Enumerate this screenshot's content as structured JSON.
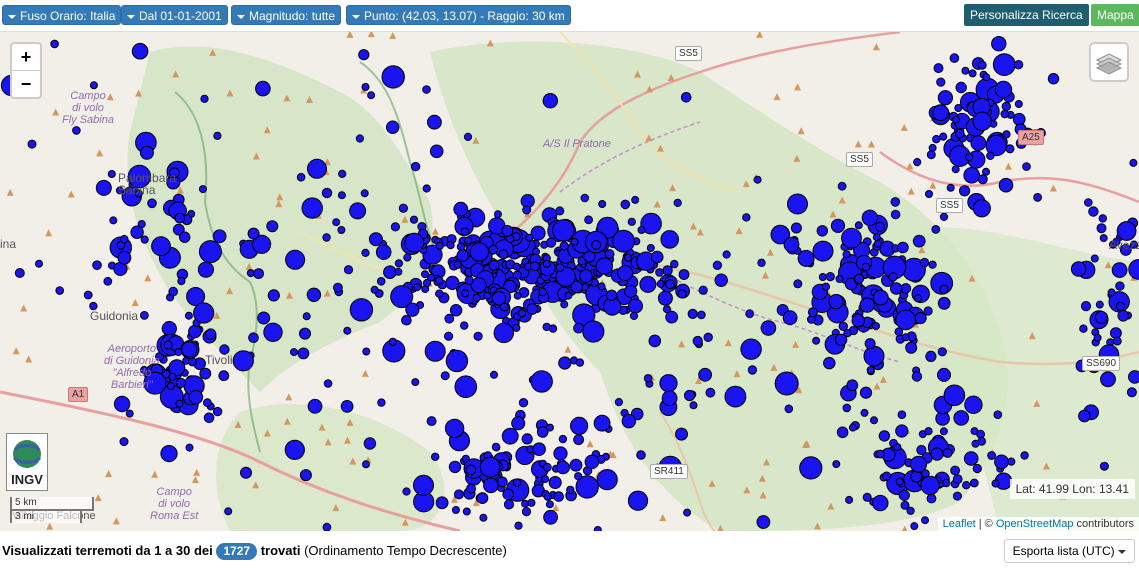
{
  "toolbar": {
    "filters": [
      {
        "label": "Fuso Orario: Italia"
      },
      {
        "label": "Dal 01-01-2001"
      },
      {
        "label": "Magnitudo: tutte"
      },
      {
        "label": "Punto: (42.03, 13.07) - Raggio: 30 km"
      }
    ],
    "customize_label": "Personalizza Ricerca",
    "map_label": "Mappa",
    "colors": {
      "primary": "#337ab7",
      "dark": "#1f5e6e",
      "green": "#5cb85c"
    }
  },
  "map": {
    "zoom_in": "+",
    "zoom_out": "−",
    "coords_readout": "Lat: 41.99 Lon: 13.41",
    "attribution": {
      "leaflet": "Leaflet",
      "sep": " | © ",
      "osm": "OpenStreetMap",
      "suffix": " contributors"
    },
    "scale": {
      "km": "5 km",
      "mi": "3 mi"
    },
    "logo_text": "INGV",
    "marker_color": "#1a14f0",
    "labels": {
      "campo_volo": "Campo\ndi volo\nFly Sabina",
      "palombara": "Palombara\nSabina",
      "guidonia": "Guidonia",
      "aeroporto": "Aeroporto\ndi Guidonia\n\"Alfredo\nBarbieri\"",
      "tivoli": "Tivoli",
      "il_pratone": "A/S Il Pratone",
      "avezzano": "Avezz",
      "ina": "ina",
      "campo_s": "Campo\ndi volo\nRoma Est",
      "villaggio": "Villaggio Falcone"
    },
    "roads": {
      "ss5_top": "SS5",
      "a25": "A25",
      "ss5b": "SS5",
      "ss5c": "SS5",
      "a1": "A1",
      "sr411": "SR411",
      "ss690": "SS690",
      "a24": "SS5"
    }
  },
  "footer": {
    "summary_prefix": "Visualizzati terremoti da 1 a 30 dei",
    "count": "1727",
    "summary_mid": "trovati",
    "summary_suffix": "(Ordinamento Tempo Decrescente)",
    "export_label": "Esporta lista (UTC)"
  }
}
